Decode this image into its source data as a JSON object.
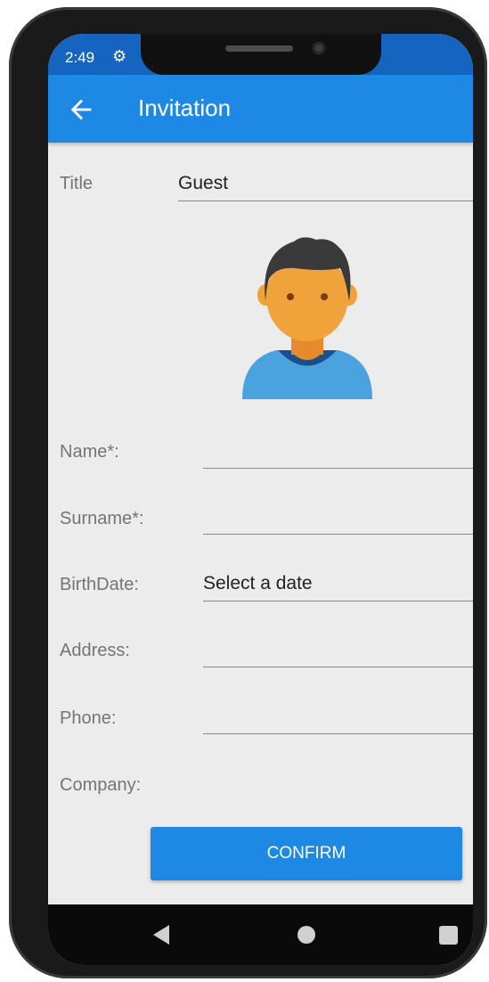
{
  "status_bar": {
    "time": "2:49",
    "settings_icon": "gear-icon"
  },
  "app_bar": {
    "title": "Invitation",
    "back_icon": "arrow-left-icon"
  },
  "form": {
    "title_label": "Title",
    "title_value": "Guest",
    "avatar_icon": "person-avatar-icon",
    "name_label": "Name*:",
    "name_value": "",
    "surname_label": "Surname*:",
    "surname_value": "",
    "birthdate_label": "BirthDate:",
    "birthdate_value": "Select a date",
    "address_label": "Address:",
    "address_value": "",
    "phone_label": "Phone:",
    "phone_value": "",
    "company_label": "Company:"
  },
  "confirm_button": {
    "label": "CONFIRM"
  },
  "nav_bar": {
    "back_icon": "triangle-back-icon",
    "home_icon": "circle-home-icon",
    "recents_icon": "square-recents-icon"
  },
  "colors": {
    "primary": "#1e88e5",
    "status_bar": "#1565c0",
    "background": "#ececec"
  }
}
